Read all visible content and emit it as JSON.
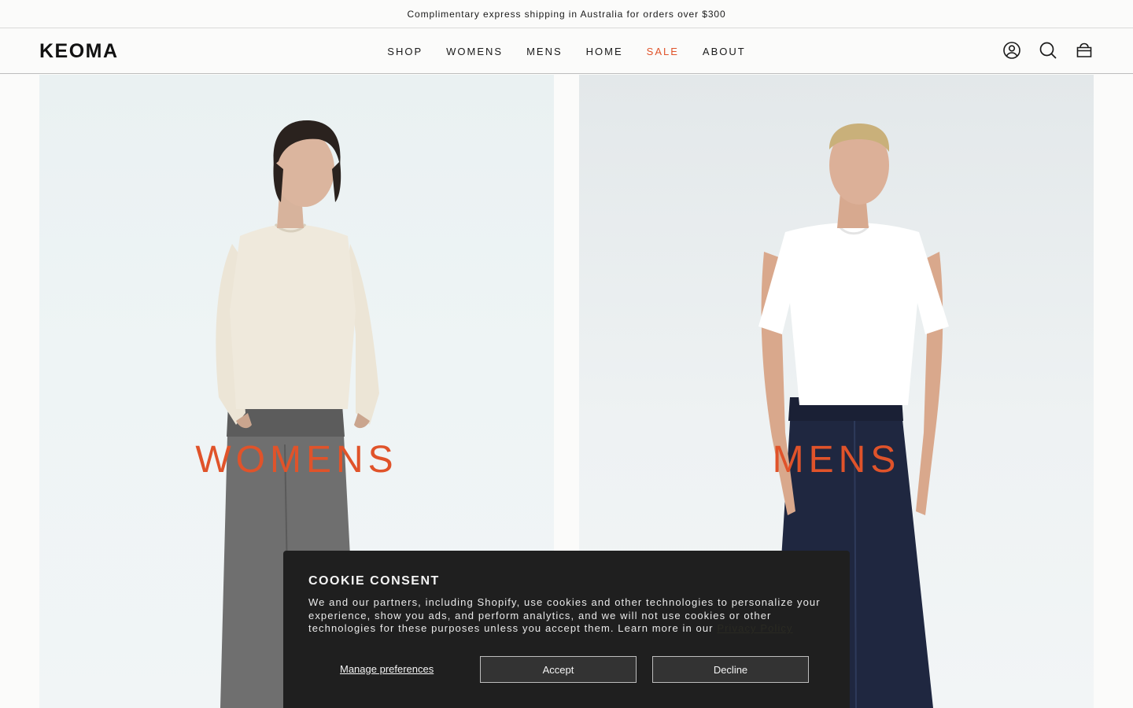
{
  "announcement": "Complimentary express shipping in Australia for orders over $300",
  "header": {
    "logo": "KEOMA",
    "nav": [
      "SHOP",
      "WOMENS",
      "MENS",
      "HOME",
      "SALE",
      "ABOUT"
    ],
    "icons": [
      "account-icon",
      "search-icon",
      "cart-icon"
    ]
  },
  "hero": {
    "left_title": "WOMENS",
    "right_title": "MENS"
  },
  "cookie": {
    "title": "COOKIE CONSENT",
    "body": "We and our partners, including Shopify, use cookies and other technologies to personalize your experience, show you ads, and perform analytics, and we will not use cookies or other technologies for these purposes unless you accept them. Learn more in our ",
    "link": "Privacy Policy",
    "manage": "Manage preferences",
    "accept": "Accept",
    "decline": "Decline"
  },
  "colors": {
    "accent": "#e0532a",
    "cookie_bg": "#1f1f1f",
    "text": "#1a1a1a"
  }
}
